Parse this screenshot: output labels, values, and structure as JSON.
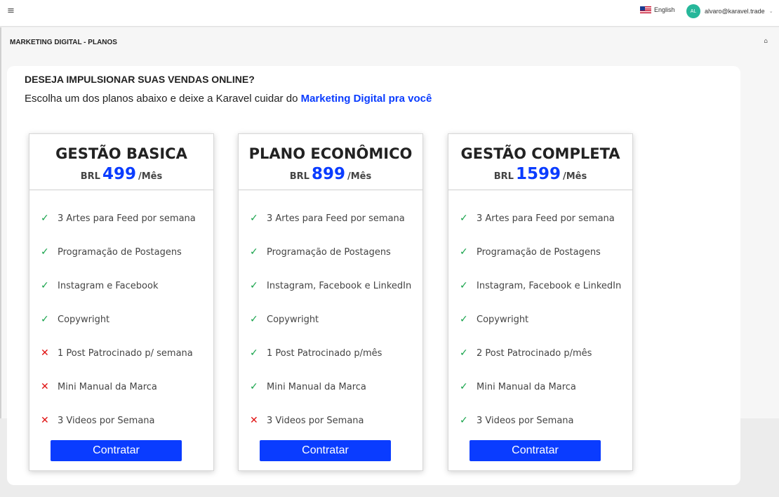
{
  "topbar": {
    "menu_icon": "≡",
    "language": "English",
    "user_initials": "AL",
    "user_email": "alvaro@karavel.trade"
  },
  "header": {
    "title": "MARKETING DIGITAL -  PLANOS"
  },
  "intro": {
    "heading": "DESEJA IMPULSIONAR SUAS VENDAS ONLINE?",
    "sub": "Escolha um dos planos abaixo e deixe a Karavel cuidar do ",
    "sub_highlight": "Marketing Digital pra você"
  },
  "colors": {
    "accent": "#0a3cff",
    "check": "#16a34a",
    "cross": "#e01010",
    "avatar": "#26b79a"
  },
  "plans": [
    {
      "name": "GESTÃO BASICA",
      "currency": "BRL",
      "price": "499",
      "period": "/Mês",
      "features": [
        {
          "text": "3 Artes para Feed por semana",
          "mark": "✓",
          "included": true
        },
        {
          "text": "Programação de Postagens",
          "mark": "✓",
          "included": true
        },
        {
          "text": "Instagram e Facebook",
          "mark": "✓",
          "included": true
        },
        {
          "text": "Copywright",
          "mark": "✓",
          "included": true
        },
        {
          "text": "1 Post Patrocinado p/ semana",
          "mark": "✕",
          "included": false
        },
        {
          "text": "Mini Manual da Marca",
          "mark": "✕",
          "included": false
        },
        {
          "text": "3 Videos por Semana",
          "mark": "✕",
          "included": false
        }
      ],
      "button": "Contratar"
    },
    {
      "name": "PLANO ECONÔMICO",
      "currency": "BRL",
      "price": "899",
      "period": "/Mês",
      "features": [
        {
          "text": "3 Artes para Feed por semana",
          "mark": "✓",
          "included": true
        },
        {
          "text": "Programação de Postagens",
          "mark": "✓",
          "included": true
        },
        {
          "text": "Instagram, Facebook e LinkedIn",
          "mark": "✓",
          "included": true
        },
        {
          "text": "Copywright",
          "mark": "✓",
          "included": true
        },
        {
          "text": "1 Post Patrocinado p/mês",
          "mark": "✓",
          "included": true
        },
        {
          "text": "Mini Manual da Marca",
          "mark": "✓",
          "included": true
        },
        {
          "text": "3 Videos por Semana",
          "mark": "✕",
          "included": false
        }
      ],
      "button": "Contratar"
    },
    {
      "name": "GESTÃO COMPLETA",
      "currency": "BRL",
      "price": "1599",
      "period": "/Mês",
      "features": [
        {
          "text": "3 Artes para Feed por semana",
          "mark": "✓",
          "included": true
        },
        {
          "text": "Programação de Postagens",
          "mark": "✓",
          "included": true
        },
        {
          "text": "Instagram, Facebook e LinkedIn",
          "mark": "✓",
          "included": true
        },
        {
          "text": "Copywright",
          "mark": "✓",
          "included": true
        },
        {
          "text": "2 Post Patrocinado p/mês",
          "mark": "✓",
          "included": true
        },
        {
          "text": "Mini Manual da Marca",
          "mark": "✓",
          "included": true
        },
        {
          "text": "3 Videos por Semana",
          "mark": "✓",
          "included": true
        }
      ],
      "button": "Contratar"
    }
  ]
}
